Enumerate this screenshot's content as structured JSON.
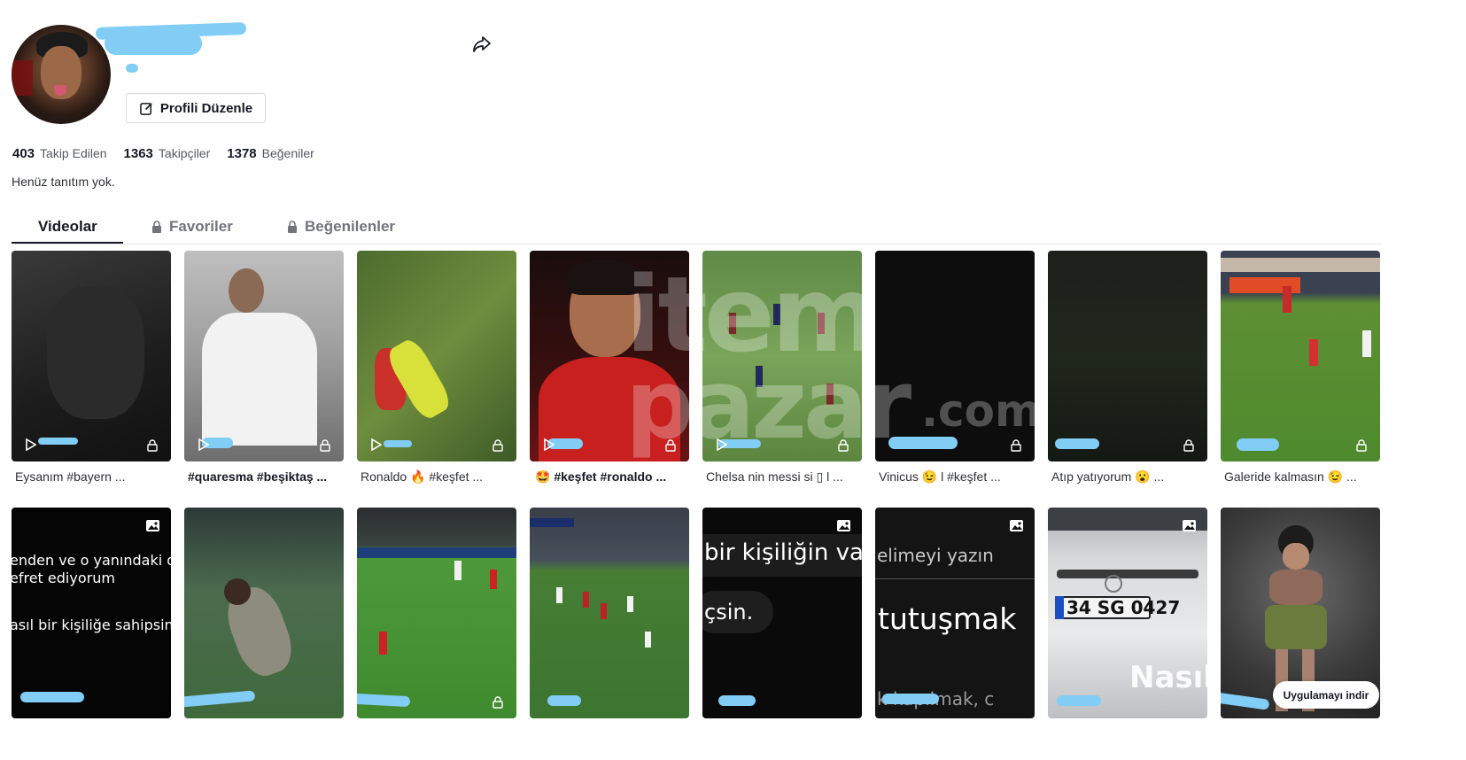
{
  "profile": {
    "edit_label": "Profili Düzenle",
    "bio": "Henüz tanıtım yok."
  },
  "stats": [
    {
      "value": "403",
      "label": "Takip Edilen"
    },
    {
      "value": "1363",
      "label": "Takipçiler"
    },
    {
      "value": "1378",
      "label": "Beğeniler"
    }
  ],
  "tabs": [
    {
      "label": "Videolar",
      "active": true
    },
    {
      "label": "Favoriler",
      "locked": true
    },
    {
      "label": "Beğenilenler",
      "locked": true
    }
  ],
  "videos_row1": [
    {
      "caption": "Eysanım #bayern ..."
    },
    {
      "caption": "#quaresma #beşiktaş ..."
    },
    {
      "caption": "Ronaldo 🔥 #keşfet ..."
    },
    {
      "caption": "🤩 #keşfet #ronaldo ..."
    },
    {
      "caption": "Chelsa nin messi si ▯ l ..."
    },
    {
      "caption": "Vinicus 😉 l #keşfet ..."
    },
    {
      "caption": "Atıp yatıyorum 😮 ..."
    },
    {
      "caption": "Galeride kalmasın 😉 ..."
    }
  ],
  "overlays": {
    "card9_line1": "enden ve o yanındaki den",
    "card9_line2": "efret ediyorum",
    "card9_line3": "asıl bir kişiliğe sahipsiniz",
    "card13_line1": "bir kişiliğin var",
    "card13_line2": "çsin.",
    "card14_line1": "elimeyi yazın",
    "card14_line2": "tutuşmak",
    "card14_line3": "k kapılmak, c",
    "card15_plate": "34 SG 0427",
    "card15_text": "Nasıl",
    "card5_watermark1": "item",
    "card5_watermark2": "pazar",
    "card5_watermark3": ".com"
  },
  "download_label": "Uygulamayı indir",
  "colors": {
    "redaction": "#82cdf5",
    "text": "#161823",
    "muted": "#73747b"
  }
}
